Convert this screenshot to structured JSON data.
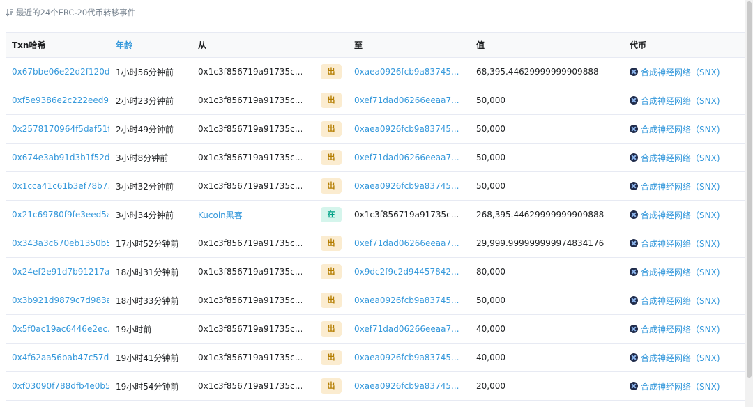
{
  "summary": {
    "text": "最近的24个ERC-20代币转移事件",
    "icon": "sort-icon"
  },
  "table": {
    "headers": {
      "txn": "Txn哈希",
      "age": "年龄",
      "from": "从",
      "dir": "",
      "to": "至",
      "value": "值",
      "token": "代币"
    },
    "rows": [
      {
        "txn": "0x67bbe06e22d2f120d...",
        "age": "1小时56分钟前",
        "from": "0x1c3f856719a91735c...",
        "dir": "出",
        "to": "0xaea0926fcb9a83745...",
        "value": "68,395.44629999999909888",
        "token": "合成神经网络（SNX)"
      },
      {
        "txn": "0xf5e9386e2c222eed9...",
        "age": "2小时23分钟前",
        "from": "0x1c3f856719a91735c...",
        "dir": "出",
        "to": "0xef71dad06266eeaa7...",
        "value": "50,000",
        "token": "合成神经网络（SNX)"
      },
      {
        "txn": "0x2578170964f5daf51f...",
        "age": "2小时49分钟前",
        "from": "0x1c3f856719a91735c...",
        "dir": "出",
        "to": "0xaea0926fcb9a83745...",
        "value": "50,000",
        "token": "合成神经网络（SNX)"
      },
      {
        "txn": "0x674e3ab91d3b1f52d...",
        "age": "3小时8分钟前",
        "from": "0x1c3f856719a91735c...",
        "dir": "出",
        "to": "0xef71dad06266eeaa7...",
        "value": "50,000",
        "token": "合成神经网络（SNX)"
      },
      {
        "txn": "0x1cca41c61b3ef78b7...",
        "age": "3小时32分钟前",
        "from": "0x1c3f856719a91735c...",
        "dir": "出",
        "to": "0xaea0926fcb9a83745...",
        "value": "50,000",
        "token": "合成神经网络（SNX)"
      },
      {
        "txn": "0x21c69780f9fe3eed5a...",
        "age": "3小时34分钟前",
        "from": "Kucoin黑客",
        "dir": "在",
        "to": "0x1c3f856719a91735c...",
        "value": "268,395.44629999999909888",
        "token": "合成神经网络（SNX)"
      },
      {
        "txn": "0x343a3c670eb1350b5...",
        "age": "17小时52分钟前",
        "from": "0x1c3f856719a91735c...",
        "dir": "出",
        "to": "0xef71dad06266eeaa7...",
        "value": "29,999.999999999974834176",
        "token": "合成神经网络（SNX)"
      },
      {
        "txn": "0x24ef2e91d7b91217af...",
        "age": "18小时31分钟前",
        "from": "0x1c3f856719a91735c...",
        "dir": "出",
        "to": "0x9dc2f9c2d94457842...",
        "value": "80,000",
        "token": "合成神经网络（SNX)"
      },
      {
        "txn": "0x3b921d9879c7d983a...",
        "age": "18小时33分钟前",
        "from": "0x1c3f856719a91735c...",
        "dir": "出",
        "to": "0xaea0926fcb9a83745...",
        "value": "50,000",
        "token": "合成神经网络（SNX)"
      },
      {
        "txn": "0x5f0ac19ac6446e2ec...",
        "age": "19小时前",
        "from": "0x1c3f856719a91735c...",
        "dir": "出",
        "to": "0xef71dad06266eeaa7...",
        "value": "40,000",
        "token": "合成神经网络（SNX)"
      },
      {
        "txn": "0x4f62aa56bab47c57d...",
        "age": "19小时41分钟前",
        "from": "0x1c3f856719a91735c...",
        "dir": "出",
        "to": "0xaea0926fcb9a83745...",
        "value": "40,000",
        "token": "合成神经网络（SNX)"
      },
      {
        "txn": "0xf03090f788dfb4e0b5...",
        "age": "19小时54分钟前",
        "from": "0x1c3f856719a91735c...",
        "dir": "出",
        "to": "0xaea0926fcb9a83745...",
        "value": "20,000",
        "token": "合成神经网络（SNX)"
      }
    ]
  },
  "colors": {
    "link": "#3498db",
    "out_badge_bg": "#fbecd0",
    "out_badge_text": "#b47d00",
    "in_badge_bg": "#d5f5ec",
    "in_badge_text": "#00a186",
    "header_bg": "#f8f9fa"
  },
  "token_icon": "snx-token-icon"
}
